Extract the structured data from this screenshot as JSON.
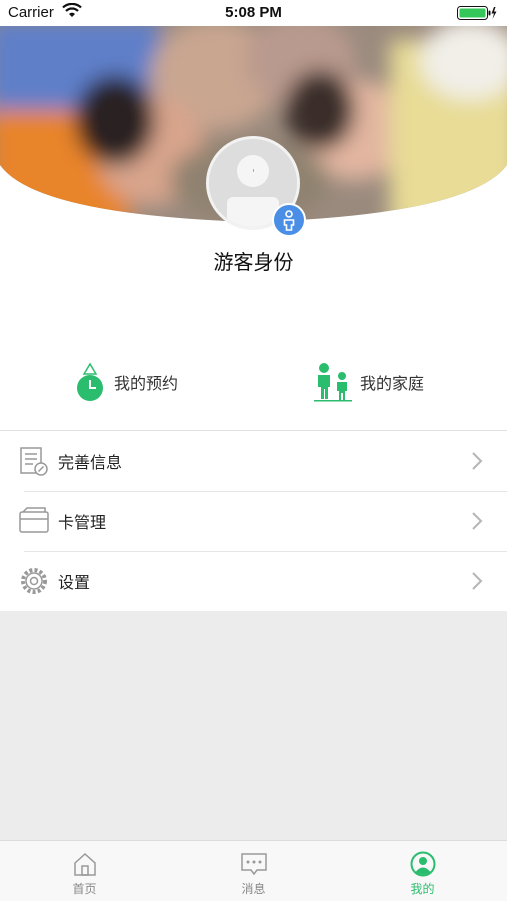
{
  "status_bar": {
    "carrier": "Carrier",
    "time": "5:08 PM"
  },
  "profile": {
    "username": "游客身份"
  },
  "quick_actions": [
    {
      "label": "我的预约",
      "icon": "clock-icon"
    },
    {
      "label": "我的家庭",
      "icon": "family-icon"
    }
  ],
  "menu": [
    {
      "label": "完善信息",
      "icon": "document-edit-icon"
    },
    {
      "label": "卡管理",
      "icon": "card-icon"
    },
    {
      "label": "设置",
      "icon": "gear-icon"
    }
  ],
  "tabbar": [
    {
      "label": "首页",
      "icon": "home-icon",
      "active": false
    },
    {
      "label": "消息",
      "icon": "message-icon",
      "active": false
    },
    {
      "label": "我的",
      "icon": "profile-icon",
      "active": true
    }
  ],
  "colors": {
    "accent": "#2bbd6e",
    "badge": "#4b8ee6",
    "background": "#ececec"
  }
}
